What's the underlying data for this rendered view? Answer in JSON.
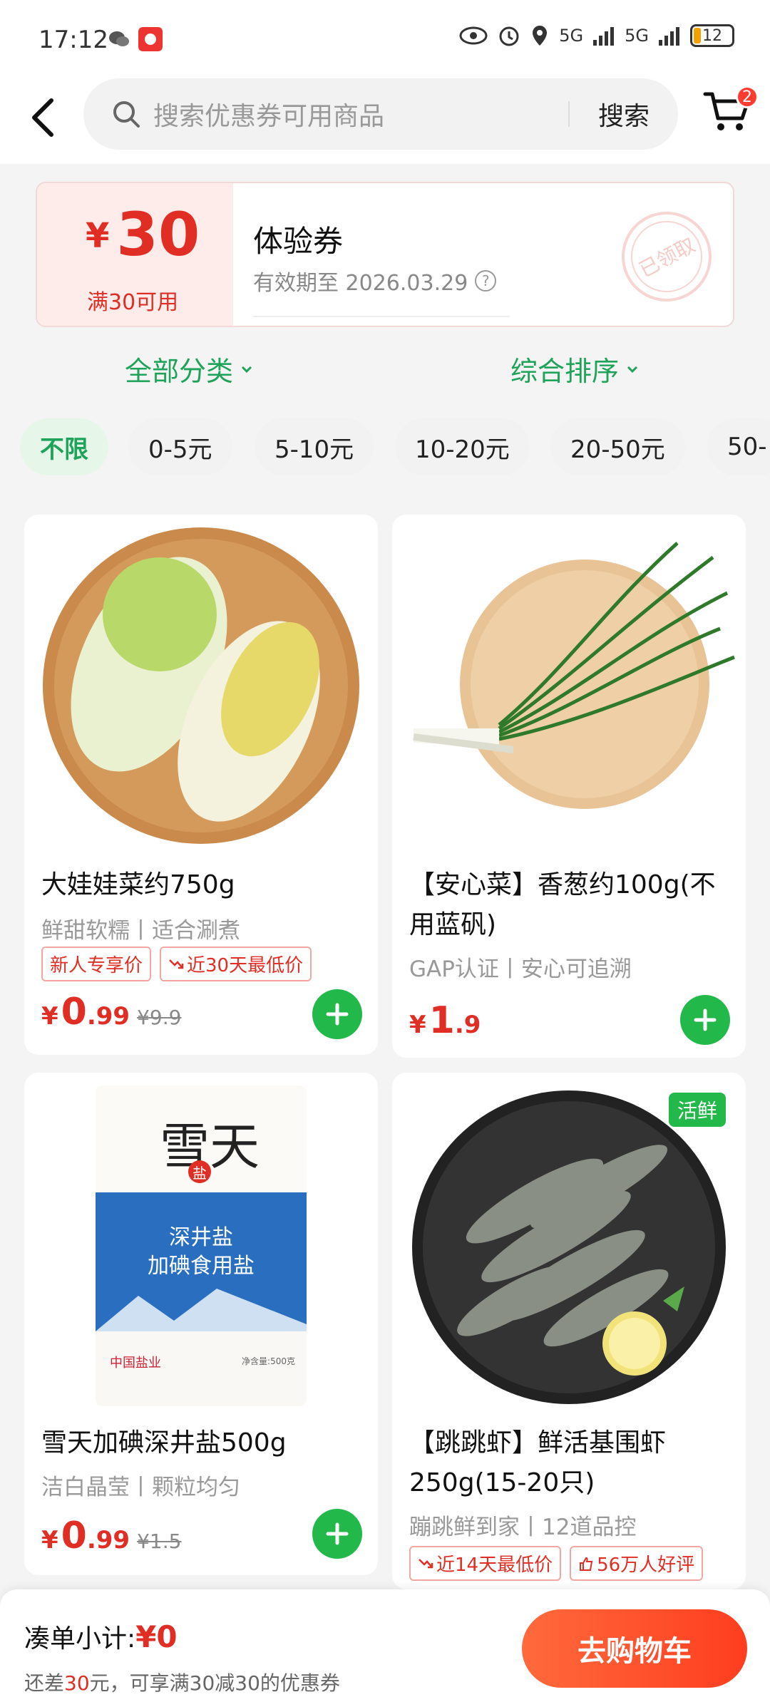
{
  "status": {
    "time": "17:12",
    "battery": "12",
    "net1": "5G",
    "net2": "5G"
  },
  "search": {
    "placeholder": "搜索优惠券可用商品",
    "button": "搜索",
    "cart_count": "2"
  },
  "coupon": {
    "yen": "¥",
    "amount": "30",
    "condition": "满30可用",
    "title": "体验券",
    "valid": "有效期至 2026.03.29",
    "stamp": "已领取"
  },
  "filters": {
    "category": "全部分类",
    "sort": "综合排序"
  },
  "chips": [
    "不限",
    "0-5元",
    "5-10元",
    "10-20元",
    "20-50元",
    "50-"
  ],
  "products": [
    {
      "name": "大娃娃菜约750g",
      "desc": "鲜甜软糯丨适合涮煮",
      "tags": [
        "新人专享价",
        "近30天最低价"
      ],
      "yen": "¥",
      "price_int": "0",
      "price_dec": ".99",
      "old": "¥9.9"
    },
    {
      "name": "【安心菜】香葱约100g(不用蓝矾)",
      "desc": "GAP认证丨安心可追溯",
      "tags": [],
      "yen": "¥",
      "price_int": "1",
      "price_dec": ".9",
      "old": ""
    },
    {
      "name": "雪天加碘深井盐500g",
      "desc": "洁白晶莹丨颗粒均匀",
      "tags": [],
      "yen": "¥",
      "price_int": "0",
      "price_dec": ".99",
      "old": "¥1.5"
    },
    {
      "name": "【跳跳虾】鲜活基围虾250g(15-20只)",
      "desc": "蹦跳鲜到家丨12道品控",
      "tags": [
        "近14天最低价",
        "56万人好评"
      ],
      "badge": "活鲜"
    }
  ],
  "salt_pack": {
    "brand": "雪天",
    "line1": "深井盐",
    "line2": "加碘食用盐",
    "seal": "盐",
    "footer": "中国盐业",
    "net": "净含量:500克"
  },
  "bottom": {
    "subtotal_label": "凑单小计:",
    "subtotal_value": "¥0",
    "hint_prefix": "还差",
    "hint_amount": "30",
    "hint_suffix": "元，可享满30减30的优惠券",
    "cart_button": "去购物车"
  },
  "colors": {
    "green": "#22b84a",
    "red": "#e02e24",
    "orange": "#ff4a25"
  }
}
